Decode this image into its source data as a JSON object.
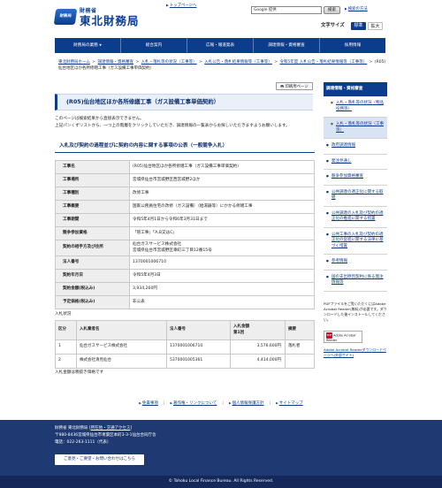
{
  "header": {
    "logo_text": "財務局",
    "site_sub": "財務省",
    "site_title": "東北財務局",
    "top_link": "トップページへ",
    "search_placeholder": "Google 提供",
    "search_button": "検索",
    "how_to_search": "検索の方法",
    "font_size_label": "文字サイズ",
    "font_normal": "標準",
    "font_large": "拡大"
  },
  "gnav": [
    {
      "label": "財務局の業務",
      "caret": "▼"
    },
    {
      "label": "総合案内",
      "caret": ""
    },
    {
      "label": "広報・報道発表",
      "caret": ""
    },
    {
      "label": "調達情報・資格審査",
      "caret": ""
    },
    {
      "label": "採用情報",
      "caret": ""
    }
  ],
  "breadcrumb": [
    "東北財務局ホーム",
    "調達情報・資格審査",
    "入札・落札等の状況（工事等）",
    "入札公告・落札結果情報等（工事等）",
    "令和5年度 入札公告・落札結果情報等（工事等）",
    "(R05)仙台地区ほか各所修繕工事（ガス設備工事単価契約）"
  ],
  "print_button": "印刷用ページ",
  "page_title": "(R05)仙台地区ほか各所修繕工事（ガス設備工事単価契約）",
  "intro": [
    "このページは検索結果から直接表示できません。",
    "上記パンくずリストから、一つ上の階層をクリックしていただき、調達情報の一覧表からお探しいただきますようお願いします。"
  ],
  "section_title": "入札及び契約の過程並びに契約の内容に関する事項の公表（一般競争入札）",
  "info_table": [
    {
      "label": "工事名",
      "value": "(R05)仙台地区ほか各所修繕工事（ガス設備工事単価契約）"
    },
    {
      "label": "工事場所",
      "value": "宮城県仙台市宮城野区西宮城野2ほか"
    },
    {
      "label": "工事種別",
      "value": "改修工事"
    },
    {
      "label": "工事概要",
      "value": "国家公務員住宅の改修（ガス設備）（給湯器等）にかかる修繕工事"
    },
    {
      "label": "工事期間",
      "value": "令和5年4月1日から令和6年3月31日まで"
    },
    {
      "label": "競争参加資格",
      "value": "「管工事」「A,B又はC」"
    },
    {
      "label": "契約の相手方及び住所",
      "value": "仙台ガスサービス株式会社\n宮城県仙台市宮城野区幸町三丁目12番15号"
    },
    {
      "label": "法人番号",
      "value": "1370001006710"
    },
    {
      "label": "契約年月日",
      "value": "令和5年4月3日"
    },
    {
      "label": "契約金額(税込み)",
      "value": "3,934,260円"
    },
    {
      "label": "予定価格(税込み)",
      "value": "非公表"
    }
  ],
  "bids": {
    "caption": "入札状況",
    "headers": [
      "区分",
      "入札業者名",
      "法人番号",
      "入札金額\n第1回",
      "摘要"
    ],
    "rows": [
      {
        "no": "1",
        "name": "仙台ガスサービス株式会社",
        "corp": "1370001006710",
        "amount": "3,576,600円",
        "note": "落札者"
      },
      {
        "no": "2",
        "name": "株式会社清見仙台",
        "corp": "5370001005361",
        "amount": "4,414,000円",
        "note": ""
      }
    ],
    "note": "入札金額は税抜き価格です"
  },
  "sidebar": {
    "head": "調達情報・資格審査",
    "items": [
      {
        "label": "入札・落札等の状況（物品役務等）",
        "sub": true,
        "active": false
      },
      {
        "label": "入札・落札等の状況（工事等）",
        "sub": true,
        "active": true
      },
      {
        "label": "政府調達情報",
        "sub": false,
        "active": false
      },
      {
        "label": "発注見通し",
        "sub": false,
        "active": false
      },
      {
        "label": "競争参加資格審査",
        "sub": false,
        "active": false
      },
      {
        "label": "公共調達の適正化に関する取組",
        "sub": false,
        "active": false
      },
      {
        "label": "公共調達の入札及び契約の適正化の推進に関する措置",
        "sub": false,
        "active": false
      },
      {
        "label": "公共工事の入札及び契約の適正化の促進に関する法律に基づく措置",
        "sub": false,
        "active": false
      },
      {
        "label": "参考情報",
        "sub": false,
        "active": false
      },
      {
        "label": "国の支出原因契約に係る発注情報等",
        "sub": false,
        "active": false
      }
    ]
  },
  "pdf": {
    "note": "PDFファイルをご覧いただくにはAdobe Acrobat Reader(無料)が必要です。ダウンロードした後インストールしてください。",
    "badge_icon": "PDF",
    "badge_text": "Adobe Acrobat Reader",
    "link": "Adobe Acrobat Readerダウンロードページへ(外部サイト)"
  },
  "footer_links": [
    "免責事項",
    "著作権・リンクについて",
    "個人情報保護方針",
    "サイトマップ"
  ],
  "footer": {
    "org": "財務省 東北財務局",
    "access": "所在地・交通アクセス",
    "address": "〒980-8436宮城県仙台市青葉区本町3-3-1仙台合同庁舎",
    "phone": "電話：022-263-1111（代表）",
    "contact_btn": "ご意見・ご要望・お問い合わせはこちら",
    "copyright": "© Tohoku Local Finance Bureau. All Rights Reserved."
  },
  "colors": {
    "brand_navy": "#0c3c8c",
    "footer_bg": "#1f3a72",
    "link": "#0b3a8a"
  }
}
